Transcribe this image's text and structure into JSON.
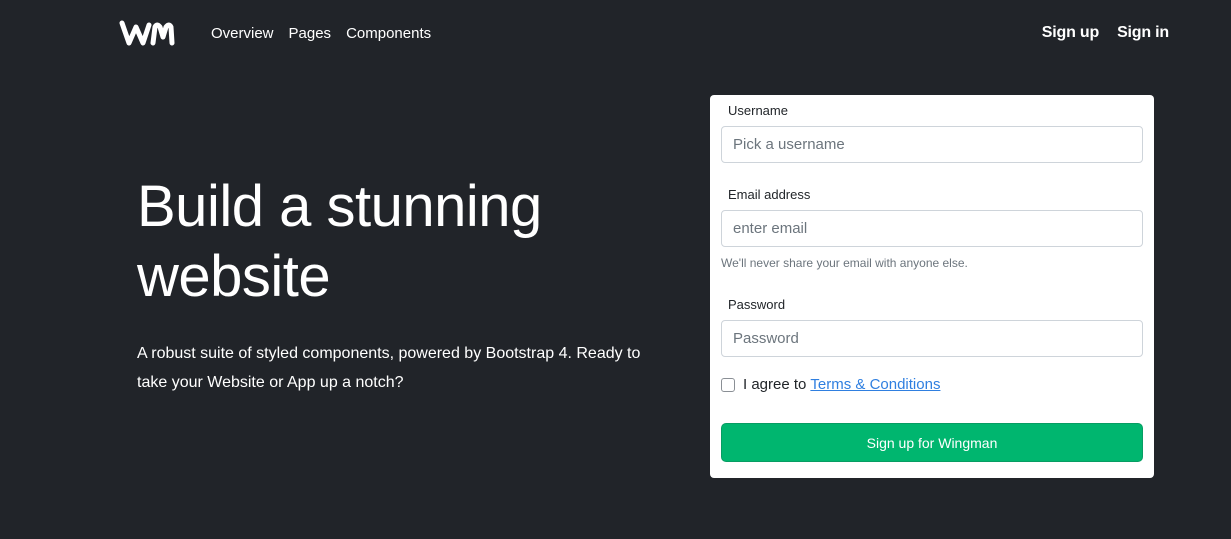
{
  "brand": {
    "logo_text": "WM"
  },
  "nav": {
    "links": [
      {
        "label": "Overview"
      },
      {
        "label": "Pages"
      },
      {
        "label": "Components"
      }
    ],
    "auth": [
      {
        "label": "Sign up"
      },
      {
        "label": "Sign in"
      }
    ]
  },
  "hero": {
    "title_line1": "Build a stunning",
    "title_line2": "website",
    "text_line1": "A robust suite of styled components, powered by Bootstrap 4. Ready to",
    "text_line2": "take your Website or App up a notch?"
  },
  "form": {
    "username": {
      "label": "Username",
      "placeholder": "Pick a username",
      "value": ""
    },
    "email": {
      "label": "Email address",
      "placeholder": "enter email",
      "value": "",
      "help": "We'll never share your email with anyone else."
    },
    "password": {
      "label": "Password",
      "placeholder": "Password",
      "value": ""
    },
    "agree": {
      "checked": false,
      "text": "I agree to",
      "link_text": "Terms & Conditions"
    },
    "submit_label": "Sign up for Wingman"
  },
  "colors": {
    "background": "#212429",
    "accent": "#00b66f",
    "link": "#2f7fe0"
  }
}
